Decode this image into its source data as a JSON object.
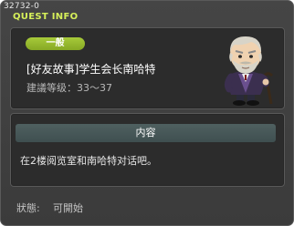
{
  "window": {
    "quest_id": "32732-0",
    "title": "QUEST INFO"
  },
  "quest": {
    "difficulty_badge": "一般",
    "name": "[好友故事]学生会长南哈特",
    "recommended_level": "建議等级：33～37",
    "npc_icon": "npc-portrait-icon"
  },
  "details": {
    "section_title": "内容",
    "description": "在2楼阅览室和南哈特对话吧。"
  },
  "status": {
    "label": "狀態:",
    "value": "可開始"
  },
  "colors": {
    "title": "#d6f05a",
    "badge": "#96b82e",
    "window_bg": "#404040",
    "panel_bg": "#2c2c2c",
    "section_header": "#475858"
  }
}
